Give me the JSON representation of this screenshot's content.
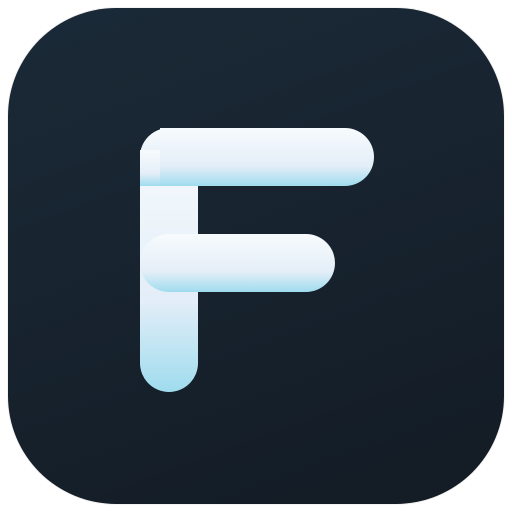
{
  "icon": {
    "logo_letter": "F",
    "logo_name": "letter-f-logo",
    "colors": {
      "background_top": "#1b2a38",
      "background_bottom": "#131b24",
      "glyph_top": "#f7fbfd",
      "glyph_mid": "#e4eef8",
      "glyph_bottom": "#9fdcee"
    }
  }
}
